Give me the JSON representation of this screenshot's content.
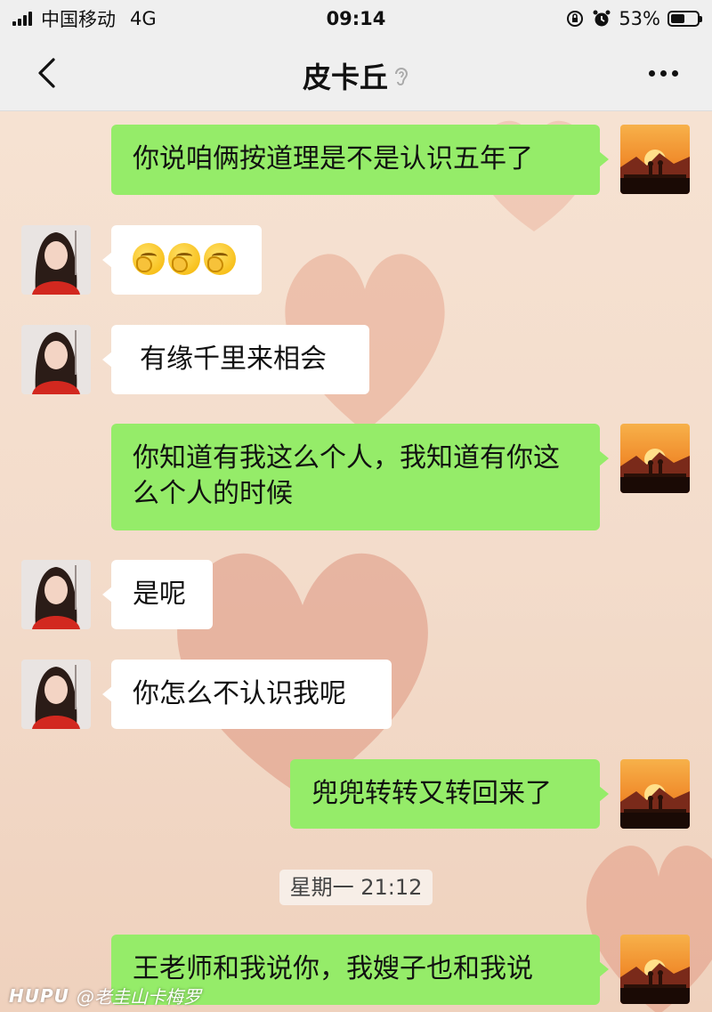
{
  "status_bar": {
    "carrier": "中国移动",
    "network": "4G",
    "time": "09:14",
    "battery_percent": "53%",
    "battery_level": 0.53
  },
  "nav": {
    "title": "皮卡丘",
    "back_icon": "chevron-left-icon",
    "ear_icon": "ear-icon",
    "more_icon": "more-dots-icon"
  },
  "messages": [
    {
      "side": "sent",
      "text": "你说咱俩按道理是不是认识五年了"
    },
    {
      "side": "received",
      "text": "",
      "emoji": [
        "thinking-face-emoji",
        "thinking-face-emoji",
        "thinking-face-emoji"
      ]
    },
    {
      "side": "received",
      "text": "有缘千里来相会"
    },
    {
      "side": "sent",
      "text": "你知道有我这么个人，我知道有你这么个人的时候"
    },
    {
      "side": "received",
      "text": "是呢"
    },
    {
      "side": "received",
      "text": "你怎么不认识我呢"
    },
    {
      "side": "sent",
      "text": "兜兜转转又转回来了"
    },
    {
      "side": "sent",
      "text": "王老师和我说你，我嫂子也和我说"
    }
  ],
  "timestamp_divider": "星期一 21:12",
  "watermark": {
    "brand": "HUPU",
    "user": "@老圭山卡梅罗"
  },
  "colors": {
    "sent_bubble": "#95ec69",
    "received_bubble": "#ffffff",
    "chat_background": "#f2dccb",
    "nav_background": "#efefef"
  }
}
